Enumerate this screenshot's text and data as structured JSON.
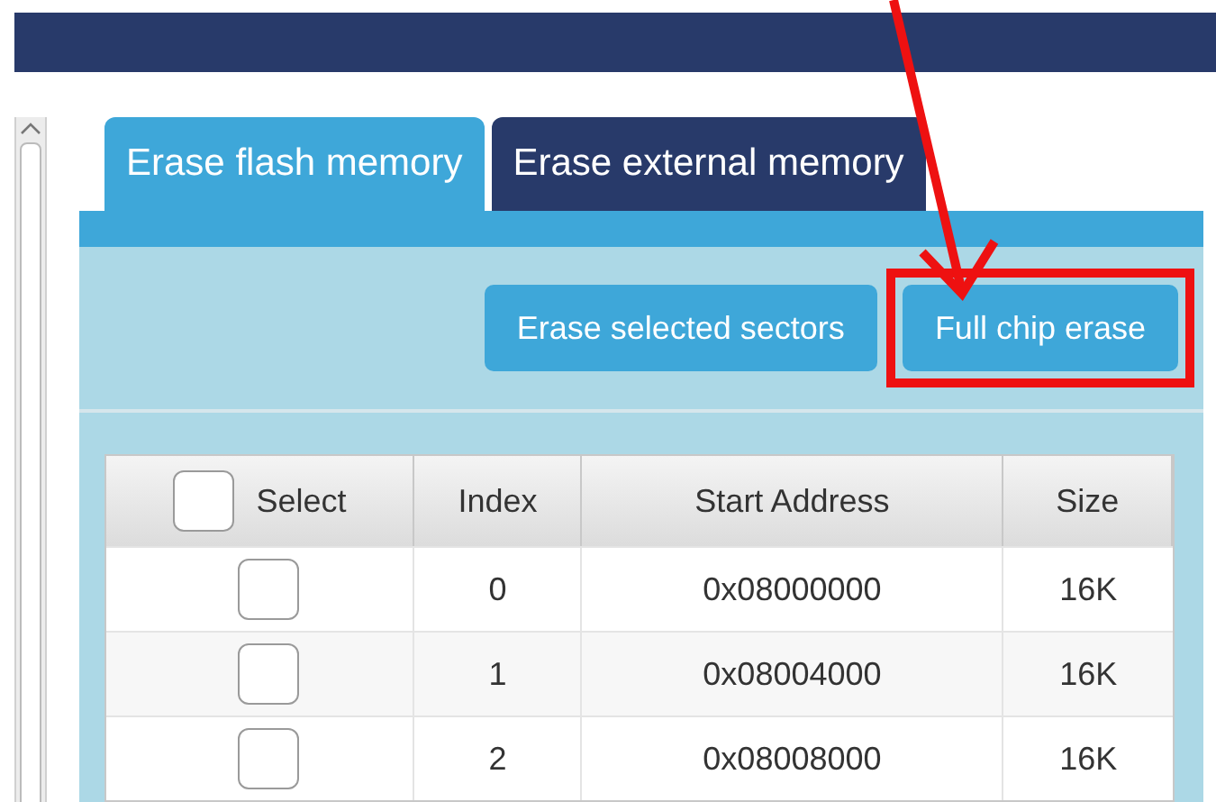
{
  "tabs": [
    {
      "label": "Erase flash memory",
      "selected": true
    },
    {
      "label": "Erase external memory",
      "selected": false
    }
  ],
  "buttons": [
    {
      "label": "Erase selected sectors",
      "highlighted": false
    },
    {
      "label": "Full chip erase",
      "highlighted": true
    }
  ],
  "table": {
    "select_all": {
      "checked": false
    },
    "columns": [
      "Select",
      "Index",
      "Start Address",
      "Size"
    ],
    "rows": [
      {
        "checked": false,
        "index": "0",
        "address": "0x08000000",
        "size": "16K"
      },
      {
        "checked": false,
        "index": "1",
        "address": "0x08004000",
        "size": "16K"
      },
      {
        "checked": false,
        "index": "2",
        "address": "0x08008000",
        "size": "16K"
      }
    ]
  }
}
